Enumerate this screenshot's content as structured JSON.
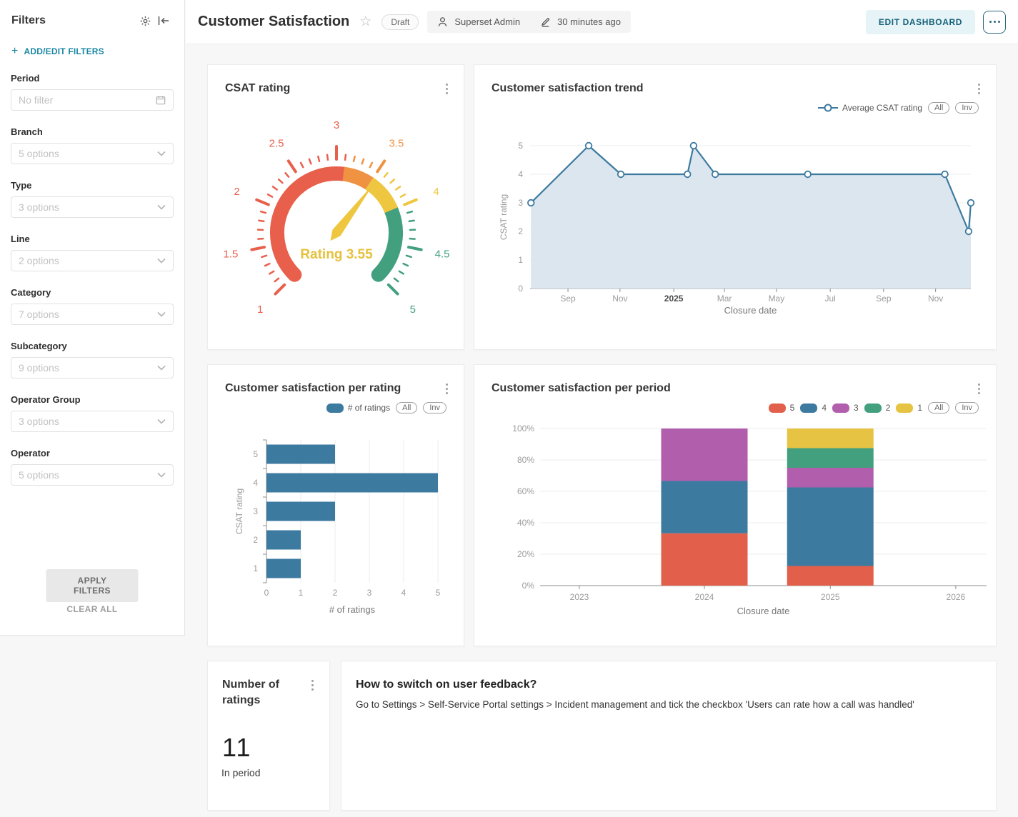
{
  "colors": {
    "primary_teal": "#1a87a3",
    "button_teal_text": "#15607a",
    "button_teal_bg": "#e6f4f8",
    "bar_blue": "#3d7aa0",
    "red": "#e2604b",
    "orange": "#ef9242",
    "yellow": "#e6c343",
    "green": "#42a07e",
    "purple": "#b15fad",
    "area_fill": "#dbe6ee"
  },
  "sidebar": {
    "title": "Filters",
    "add_edit": "ADD/EDIT FILTERS",
    "filters": [
      {
        "label": "Period",
        "value": "No filter",
        "icon": "calendar"
      },
      {
        "label": "Branch",
        "value": "5 options",
        "icon": "chevron"
      },
      {
        "label": "Type",
        "value": "3 options",
        "icon": "chevron"
      },
      {
        "label": "Line",
        "value": "2 options",
        "icon": "chevron"
      },
      {
        "label": "Category",
        "value": "7 options",
        "icon": "chevron"
      },
      {
        "label": "Subcategory",
        "value": "9 options",
        "icon": "chevron"
      },
      {
        "label": "Operator Group",
        "value": "3 options",
        "icon": "chevron"
      },
      {
        "label": "Operator",
        "value": "5 options",
        "icon": "chevron"
      }
    ],
    "apply_label": "APPLY FILTERS",
    "clear_label": "CLEAR ALL"
  },
  "header": {
    "title": "Customer Satisfaction",
    "status_badge": "Draft",
    "owner": "Superset Admin",
    "modified": "30 minutes ago",
    "edit_button": "EDIT DASHBOARD"
  },
  "cards": {
    "gauge": {
      "title": "CSAT rating"
    },
    "trend": {
      "title": "Customer satisfaction trend",
      "legend": "Average CSAT rating"
    },
    "rating": {
      "title": "Customer satisfaction per rating",
      "legend": "# of ratings"
    },
    "period": {
      "title": "Customer satisfaction per period"
    },
    "number": {
      "title": "Number of ratings",
      "value": "11",
      "subtitle": "In period"
    },
    "markdown": {
      "heading": "How to switch on user feedback?",
      "body": "Go to Settings > Self-Service Portal settings > Incident management and tick the checkbox 'Users can rate how a call was handled'"
    }
  },
  "legend_controls": {
    "all": "All",
    "inv": "Inv"
  },
  "chart_data": [
    {
      "id": "gauge",
      "type": "gauge",
      "title": "CSAT rating",
      "min": 1,
      "max": 5,
      "value": 3.55,
      "center_label": "Rating 3.55",
      "start_angle": 225,
      "end_angle": -45,
      "segments": [
        {
          "to": 3.1,
          "color": "#e8604c"
        },
        {
          "to": 3.5,
          "color": "#ef9242"
        },
        {
          "to": 4.0,
          "color": "#eec63f"
        },
        {
          "to": 5.0,
          "color": "#42a07e"
        }
      ],
      "tick_labels": [
        1,
        1.5,
        2,
        2.5,
        3,
        3.5,
        4,
        4.5,
        5
      ],
      "needle_color": "#eec63f",
      "center_label_color": "#e5c13c"
    },
    {
      "id": "trend",
      "type": "line",
      "title": "Customer satisfaction trend",
      "legend": "Average CSAT rating",
      "legend_position": "top-right",
      "grid": true,
      "line_color": "#3d7aa0",
      "area": true,
      "area_color": "#dbe6ee",
      "ylabel": "CSAT rating",
      "xlabel": "Closure date",
      "ylim": [
        0,
        5
      ],
      "yticks": [
        0,
        1,
        2,
        3,
        4,
        5
      ],
      "xticks": [
        {
          "f": 0.086,
          "label": "Sep"
        },
        {
          "f": 0.204,
          "label": "Nov"
        },
        {
          "f": 0.326,
          "label": "2025",
          "bold": true
        },
        {
          "f": 0.441,
          "label": "Mar"
        },
        {
          "f": 0.559,
          "label": "May"
        },
        {
          "f": 0.681,
          "label": "Jul"
        },
        {
          "f": 0.802,
          "label": "Sep"
        },
        {
          "f": 0.92,
          "label": "Nov"
        }
      ],
      "points": [
        {
          "f": 0.002,
          "y": 3
        },
        {
          "f": 0.133,
          "y": 5
        },
        {
          "f": 0.206,
          "y": 4
        },
        {
          "f": 0.357,
          "y": 4
        },
        {
          "f": 0.371,
          "y": 5
        },
        {
          "f": 0.42,
          "y": 4
        },
        {
          "f": 0.63,
          "y": 4
        },
        {
          "f": 0.941,
          "y": 4
        },
        {
          "f": 0.995,
          "y": 2
        },
        {
          "f": 1.0,
          "y": 3
        }
      ]
    },
    {
      "id": "perRating",
      "type": "bar",
      "orientation": "horizontal",
      "title": "Customer satisfaction per rating",
      "legend": "# of ratings",
      "bar_color": "#3d7aa0",
      "categories": [
        "5",
        "4",
        "3",
        "2",
        "1"
      ],
      "values": [
        2,
        5,
        2,
        1,
        1
      ],
      "xlabel": "# of ratings",
      "ylabel": "CSAT rating",
      "xlim": [
        0,
        5
      ],
      "xticks": [
        0,
        1,
        2,
        3,
        4,
        5
      ],
      "grid": true
    },
    {
      "id": "perPeriod",
      "type": "bar",
      "subtype": "stacked-percent",
      "title": "Customer satisfaction per period",
      "xlabel": "Closure date",
      "categories": [
        "2023",
        "2024",
        "2025",
        "2026"
      ],
      "category_f": [
        0.088,
        0.368,
        0.65,
        0.931
      ],
      "yticks_percent": [
        0,
        20,
        40,
        60,
        80,
        100
      ],
      "series": [
        {
          "name": "5",
          "color": "#e2604b",
          "values_percent": [
            0,
            33.3,
            12.5,
            0
          ]
        },
        {
          "name": "4",
          "color": "#3d7aa0",
          "values_percent": [
            0,
            33.3,
            50.0,
            0
          ]
        },
        {
          "name": "3",
          "color": "#b15fad",
          "values_percent": [
            0,
            33.4,
            12.5,
            0
          ]
        },
        {
          "name": "2",
          "color": "#42a07e",
          "values_percent": [
            0,
            0,
            12.5,
            0
          ]
        },
        {
          "name": "1",
          "color": "#e6c343",
          "values_percent": [
            0,
            0,
            12.5,
            0
          ]
        }
      ],
      "legend_order": [
        "5",
        "4",
        "3",
        "2",
        "1"
      ],
      "grid": true
    },
    {
      "id": "bigNumber",
      "type": "big_number",
      "title": "Number of ratings",
      "value": 11,
      "subtitle": "In period"
    }
  ]
}
